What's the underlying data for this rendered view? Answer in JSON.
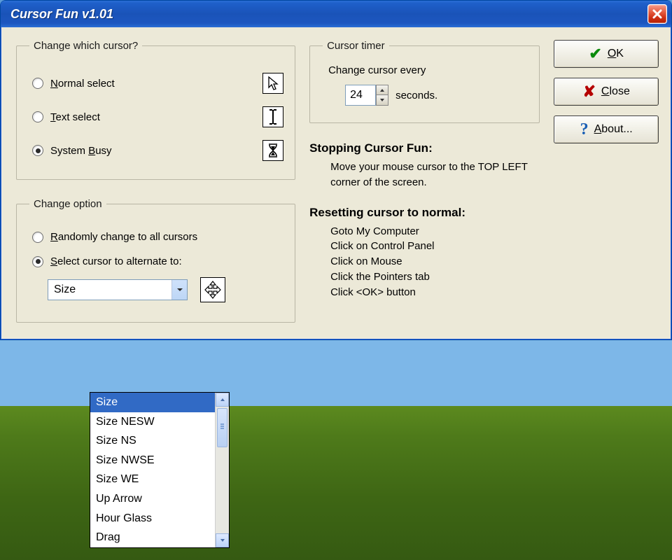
{
  "window": {
    "title": "Cursor Fun v1.01"
  },
  "group_cursor": {
    "legend": "Change which cursor?",
    "options": [
      {
        "label": "Normal select",
        "icon": "arrow-cursor",
        "checked": false
      },
      {
        "label": "Text select",
        "icon": "ibeam-cursor",
        "checked": false
      },
      {
        "label": "System Busy",
        "icon": "hourglass-cursor",
        "checked": true
      }
    ]
  },
  "group_option": {
    "legend": "Change option",
    "random_label": "Randomly change to all cursors",
    "select_label": "Select cursor to alternate to:",
    "selected_mode": "select",
    "combo_value": "Size",
    "preview_icon": "move-cursor",
    "dropdown_items": [
      "Size",
      "Size NESW",
      "Size NS",
      "Size NWSE",
      "Size WE",
      "Up Arrow",
      "Hour Glass",
      "Drag"
    ],
    "dropdown_selected_index": 0
  },
  "group_timer": {
    "legend": "Cursor timer",
    "prompt": "Change cursor every",
    "value": "24",
    "unit": "seconds."
  },
  "info": {
    "stop_heading": "Stopping Cursor Fun:",
    "stop_body": "Move your mouse cursor to the TOP LEFT corner of the screen.",
    "reset_heading": "Resetting cursor to normal:",
    "reset_lines": [
      "Goto My Computer",
      "Click on Control Panel",
      "Click on Mouse",
      "Click the Pointers tab",
      "Click <OK> button"
    ]
  },
  "buttons": {
    "ok": "OK",
    "close": "Close",
    "about": "About..."
  }
}
